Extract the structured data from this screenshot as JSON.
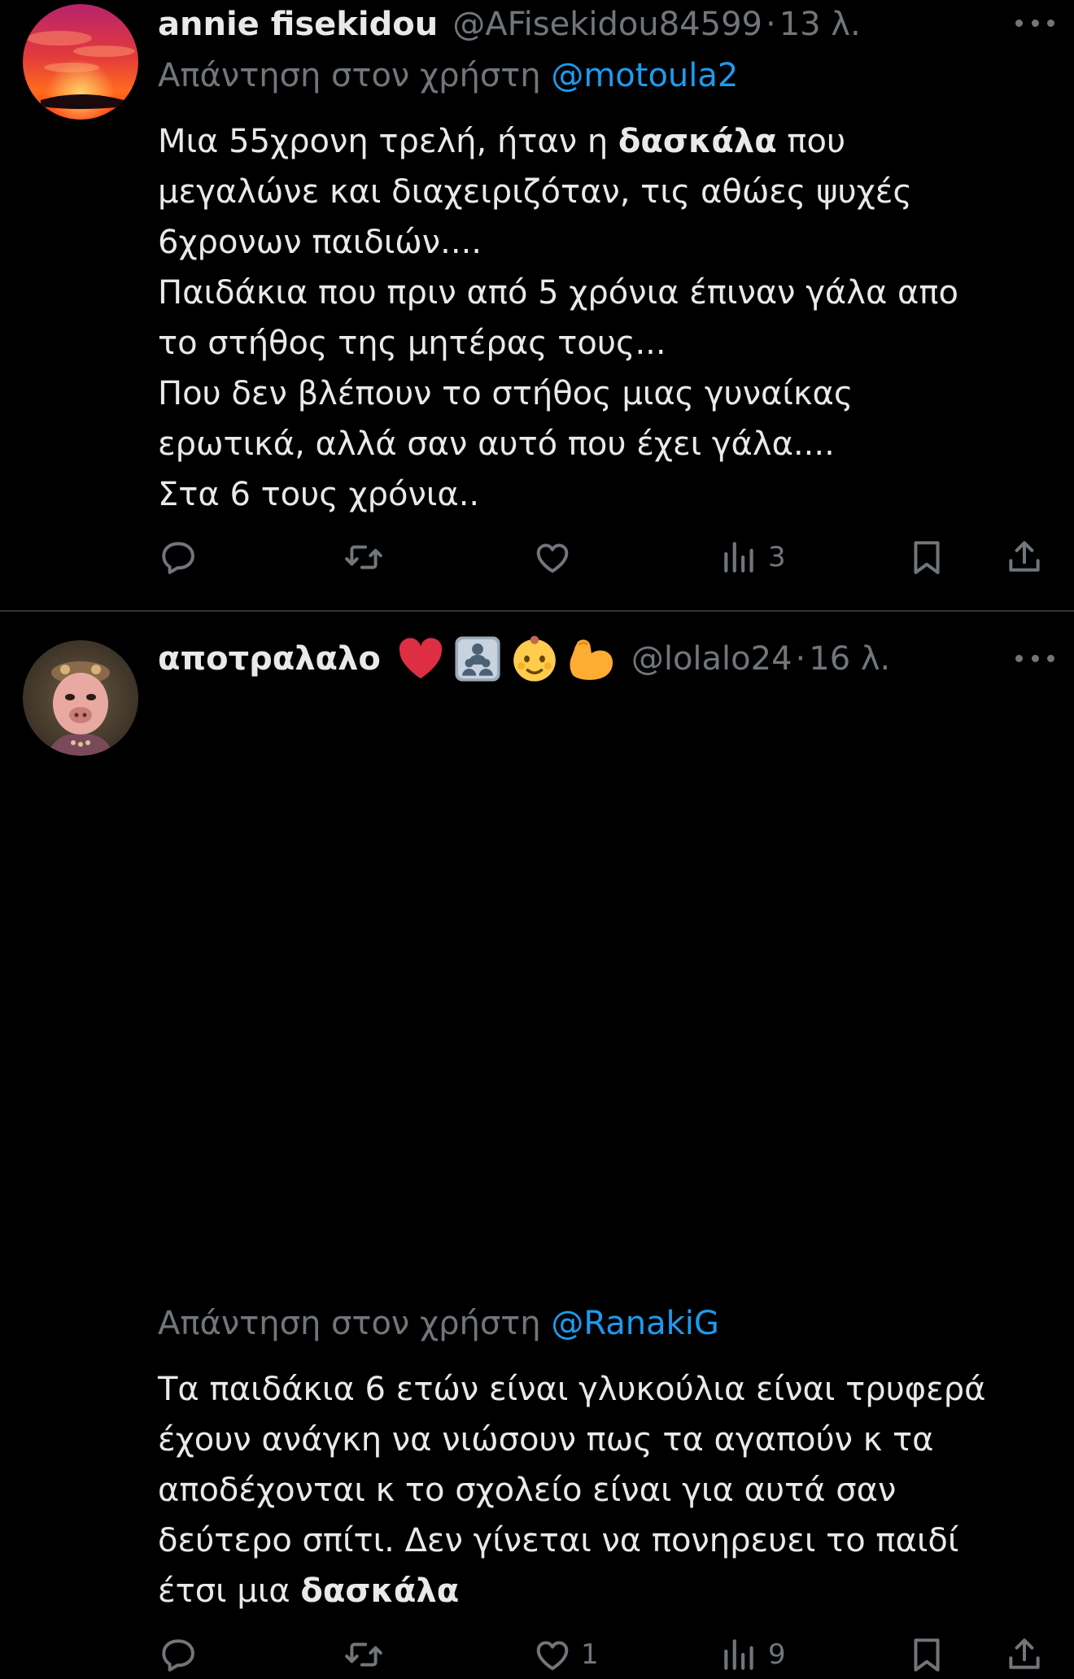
{
  "tweets": [
    {
      "display_name": "annie fisekidou",
      "handle": "@AFisekidou84599",
      "separator": "·",
      "time": "13 λ.",
      "reply_prefix": "Απάντηση στον χρήστη",
      "reply_mention": "@motoula2",
      "body_lines": [
        [
          "Μια 55χρονη  τρελή, ήταν η ",
          "δασκάλα",
          " που"
        ],
        [
          "μεγαλώνε και διαχειριζόταν, τις αθώες ψυχές"
        ],
        [
          "6χρονων παιδιών...."
        ],
        [
          "Παιδάκια που πριν από 5 χρόνια έπιναν γάλα απο"
        ],
        [
          "το στήθος της μητέρας τους..."
        ],
        [
          "Που δεν βλέπουν το στήθος μιας γυναίκας"
        ],
        [
          "ερωτικά, αλλά σαν αυτό που έχει γάλα...."
        ],
        [
          "Στα 6 τους χρόνια.."
        ]
      ],
      "actions": {
        "replies": "",
        "retweets": "",
        "likes": "",
        "views": "3"
      },
      "icons": [
        "reply-icon",
        "retweet-icon",
        "like-icon",
        "views-icon",
        "bookmark-icon",
        "share-icon"
      ]
    },
    {
      "display_name": "αποτραλαλο",
      "name_emojis": [
        "red-heart-emoji",
        "family-emoji",
        "baby-emoji",
        "flexed-biceps-emoji"
      ],
      "handle": "@lolalo24",
      "separator": "·",
      "time": "16 λ.",
      "reply_prefix": "Απάντηση στον χρήστη",
      "reply_mention": "@RanakiG",
      "body_lines": [
        [
          "Τα παιδάκια 6 ετών είναι γλυκούλια είναι τρυφερά"
        ],
        [
          "έχουν ανάγκη να νιώσουν πως τα αγαπούν κ τα"
        ],
        [
          "αποδέχονται κ το σχολείο είναι για αυτά σαν"
        ],
        [
          "δεύτερο σπίτι. Δεν γίνεται να πονηρευει το παιδί"
        ],
        [
          "έτσι μια ",
          "δασκάλα"
        ]
      ],
      "actions": {
        "replies": "",
        "retweets": "",
        "likes": "1",
        "views": "9"
      },
      "icons": [
        "reply-icon",
        "retweet-icon",
        "like-icon",
        "views-icon",
        "bookmark-icon",
        "share-icon"
      ]
    }
  ],
  "colors": {
    "background": "#000000",
    "text_primary": "#e7e9ea",
    "text_secondary": "#71767b",
    "link": "#1d9bf0",
    "divider": "#2f3336"
  }
}
